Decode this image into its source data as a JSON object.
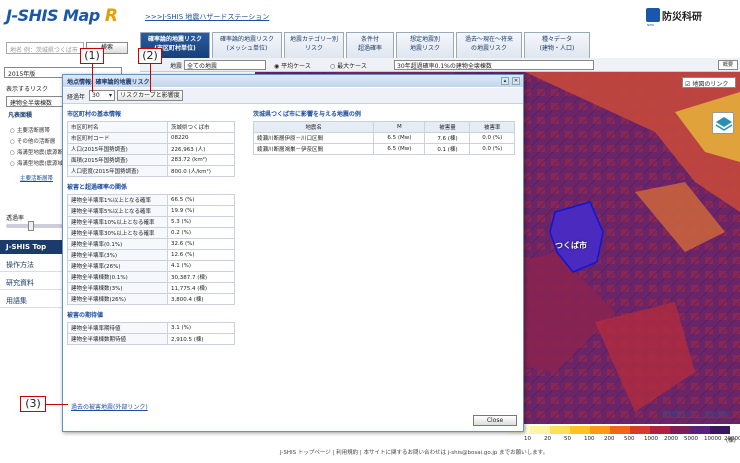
{
  "header": {
    "logo_main": "J-SHIS Map",
    "logo_r": "R",
    "home_link": ">>>J-SHIS 地震ハザードステーション",
    "org": "防災科研",
    "org_sub": "NIED"
  },
  "search": {
    "placeholder": "地名 例：茨城県つくば市",
    "button": "検索"
  },
  "tabs": [
    {
      "label": "確率論的地震リスク\n(市区町村単位)",
      "active": true
    },
    {
      "label": "確率論的地震リスク\n(メッシュ単位)",
      "active": false
    },
    {
      "label": "地震カテゴリー別\nリスク",
      "active": false
    },
    {
      "label": "条件付\n超過確率",
      "active": false
    },
    {
      "label": "想定地震別\n地震リスク",
      "active": false
    },
    {
      "label": "過去〜現在〜将来\nの地震リスク",
      "active": false
    },
    {
      "label": "種々データ\n(建物・人口)",
      "active": false
    }
  ],
  "toolbar": {
    "area_label": "地震",
    "area_value": "全ての地震",
    "avg_case": "平均ケース",
    "max_case": "最大ケース",
    "prob_value": "30年超過確率0.1%の建物全壊棟数",
    "summary": "概要"
  },
  "sidebar": {
    "year": "2015年版",
    "display_label": "表示するリスク",
    "risk_value": "建物全半壊棟数",
    "section_head": "凡表面積",
    "radios": [
      "主要活断層帯",
      "その他の活断層",
      "海溝型地震(震源断層)",
      "海溝型地震(震源域)"
    ],
    "more_link": "主要活断層帯",
    "alpha_label": "透過率",
    "menu_top": "J-SHIS Top",
    "menu": [
      "操作方法",
      "研究資料",
      "用語集"
    ]
  },
  "dialog": {
    "title": "地点情報: 確率論的地震リスク",
    "ke_label": "経過年",
    "ke_value": "30",
    "curve_btn": "リスクカーブと影響度",
    "basic_head": "市区町村の基本情報",
    "basic_rows": [
      {
        "k": "市区町村名",
        "v": "茨城県つくば市"
      },
      {
        "k": "市区町村コード",
        "v": "08220"
      },
      {
        "k": "人口(2015年国勢調査)",
        "v": "226,963 (人)"
      },
      {
        "k": "面積(2015年国勢調査)",
        "v": "283.72 (km²)"
      },
      {
        "k": "人口密度(2015年国勢調査)",
        "v": "800.0 (人/km²)"
      }
    ],
    "damage_head": "被害と超過確率の関係",
    "damage_rows": [
      {
        "k": "建物全半壊率1%以上となる確率",
        "v": "66.5 (%)"
      },
      {
        "k": "建物全半壊率5%以上となる確率",
        "v": "19.9 (%)"
      },
      {
        "k": "建物全半壊率10%以上となる確率",
        "v": "5.3 (%)"
      },
      {
        "k": "建物全半壊率30%以上となる確率",
        "v": "0.2 (%)"
      },
      {
        "k": "建物全半壊率(0.1%)",
        "v": "32.6 (%)"
      },
      {
        "k": "建物全半壊率(3%)",
        "v": "12.6 (%)"
      },
      {
        "k": "建物全半壊率(26%)",
        "v": "4.1 (%)"
      },
      {
        "k": "建物全半壊棟数(0.1%)",
        "v": "30,387.7 (棟)"
      },
      {
        "k": "建物全半壊棟数(3%)",
        "v": "11,775.4 (棟)"
      },
      {
        "k": "建物全半壊棟数(26%)",
        "v": "3,800.4 (棟)"
      }
    ],
    "expect_head": "被害の期待値",
    "expect_rows": [
      {
        "k": "建物全半壊率期待値",
        "v": "3.1 (%)"
      },
      {
        "k": "建物全半壊棟数期待値",
        "v": "2,910.5 (棟)"
      }
    ],
    "right_head": "茨城県つくば市に影響を与える地震の例",
    "right_cols": [
      "地震名",
      "M",
      "被害量",
      "被害率"
    ],
    "right_rows": [
      [
        "綾瀬川断層伊原－川口区間",
        "6.5 (Mw)",
        "7.6 (棟)",
        "0.0 (%)"
      ],
      [
        "綾瀬川断層鴻巣－伊奈区間",
        "6.5 (Mw)",
        "0.1 (棟)",
        "0.0 (%)"
      ]
    ],
    "past_link": "過去の被害地震(外部リンク)",
    "close": "Close"
  },
  "callouts": [
    "(1)",
    "(2)",
    "(3)"
  ],
  "map": {
    "city_label": "つくば市",
    "maplink": "地図のリンク",
    "tile_link": "地理院タイル（淡色地図）"
  },
  "legend": {
    "ticks": [
      "10",
      "20",
      "50",
      "100",
      "200",
      "500",
      "1000",
      "2000",
      "5000",
      "10000",
      "20000"
    ],
    "unit": "(棟)",
    "colors": [
      "#fffde0",
      "#fff3a8",
      "#ffdf5a",
      "#ffc21f",
      "#ff9a14",
      "#f2641a",
      "#d83a2a",
      "#b0203f",
      "#7d1d5a",
      "#5b1f7d",
      "#3a1660"
    ]
  },
  "footer": {
    "links": "J-SHIS トップページ | 利用規約 | 本サイトに関するお問い合わせは j-shis@bosai.go.jp までお願いします。"
  }
}
